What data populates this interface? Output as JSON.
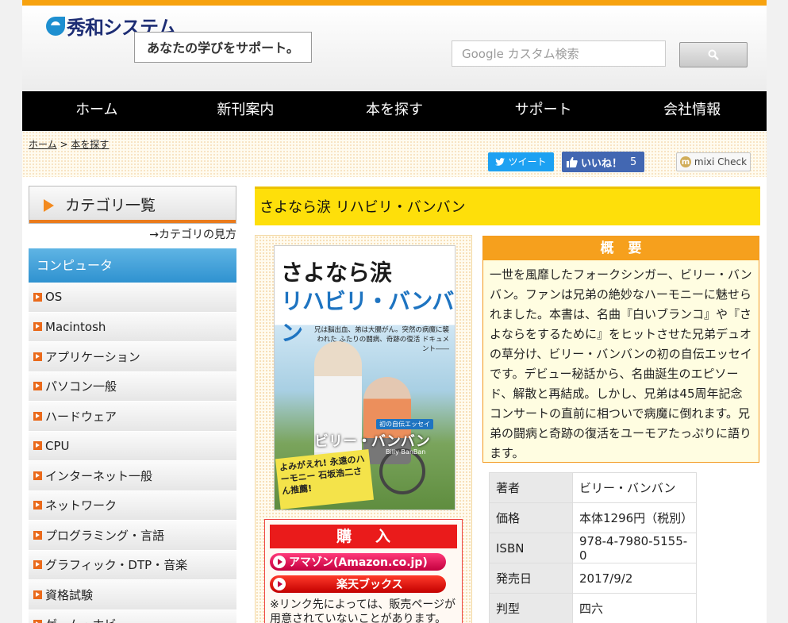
{
  "header": {
    "logo": "秀和システム",
    "tagline": "あなたの学びをサポート。",
    "search_placeholder": "Google カスタム検索"
  },
  "nav": [
    "ホーム",
    "新刊案内",
    "本を探す",
    "サポート",
    "会社情報"
  ],
  "breadcrumb": {
    "home": "ホーム",
    "sep": ">",
    "current": "本を探す"
  },
  "share": {
    "tweet": "ツイート",
    "like": "いいね！",
    "like_count": "5",
    "mixi": "mixi Check"
  },
  "sidebar": {
    "heading": "カテゴリ一覧",
    "howto": "→カテゴリの見方",
    "section": "コンピュータ",
    "items": [
      "OS",
      "Macintosh",
      "アプリケーション",
      "パソコン一般",
      "ハードウェア",
      "CPU",
      "インターネット一般",
      "ネットワーク",
      "プログラミング・言語",
      "グラフィック・DTP・音楽",
      "資格試験",
      "ゲーム・ホビー"
    ]
  },
  "book": {
    "title": "さよなら涙 リハビリ・バンバン",
    "cover": {
      "title1": "さよなら涙",
      "title2": "リハビリ・バンバン",
      "sub": "兄は脳出血、弟は大腸がん。突然の病魔に襲われた ふたりの闘病、奇跡の復活 ドキュメント――",
      "badge": "初の自伝エッセイ",
      "author": "ビリー・バンバン",
      "author_en": "Billy BanBan",
      "blurb": "よみがえれ! 永遠のハーモニー 石坂浩二さん推薦!"
    }
  },
  "purchase": {
    "heading": "購入",
    "amazon": "アマゾン(Amazon.co.jp)",
    "rakuten": "楽天ブックス",
    "note": "※リンク先によっては、販売ページが用意されていないことがあります。"
  },
  "summary": {
    "heading": "概要",
    "text": "一世を風靡したフォークシンガー、ビリー・バンバン。ファンは兄弟の絶妙なハーモニーに魅せられました。本書は、名曲『白いブランコ』や『さよならをするために』をヒットさせた兄弟デュオの草分け、ビリー・バンバンの初の自伝エッセイです。デビュー秘話から、名曲誕生のエピソード、解散と再結成。しかし、兄弟は45周年記念コンサートの直前に相ついで病魔に倒れます。兄弟の闘病と奇跡の復活をユーモアたっぷりに語ります。"
  },
  "specs": [
    {
      "key": "著者",
      "value": "ビリー・バンバン"
    },
    {
      "key": "価格",
      "value": "本体1296円（税別）"
    },
    {
      "key": "ISBN",
      "value": "978-4-7980-5155-0"
    },
    {
      "key": "発売日",
      "value": "2017/9/2"
    },
    {
      "key": "判型",
      "value": "四六"
    }
  ],
  "colors": {
    "accent": "#f7a20f",
    "nav": "#000000",
    "title_bar": "#fedf0a",
    "category": "#2f92d0",
    "buy": "#ea1b1b"
  }
}
